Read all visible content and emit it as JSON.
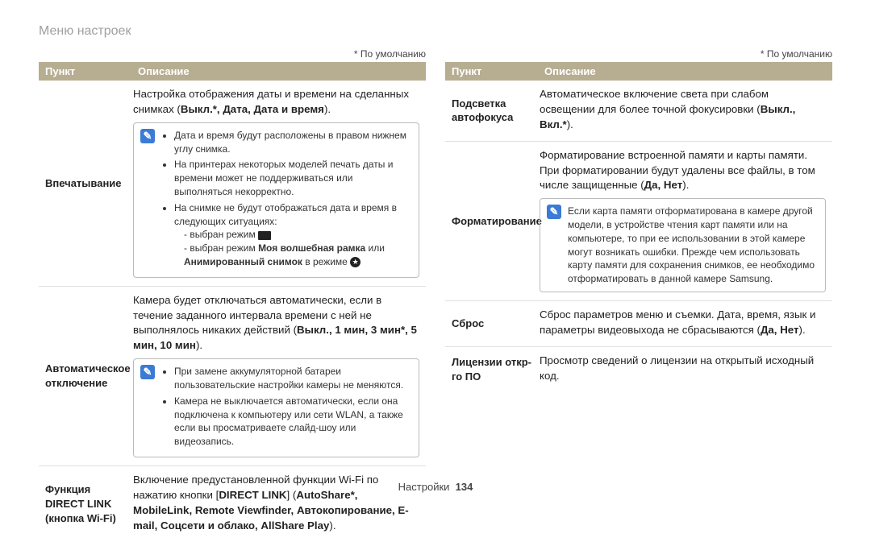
{
  "title": "Меню настроек",
  "default_label": "* По умолчанию",
  "headers": {
    "item": "Пункт",
    "desc": "Описание"
  },
  "footer": {
    "section": "Настройки",
    "page": "134"
  },
  "left": {
    "rows": [
      {
        "label": "Впечатывание",
        "intro_pre": "Настройка отображения даты и времени на сделанных снимках (",
        "intro_bold": "Выкл.*, Дата, Дата и время",
        "intro_post": ").",
        "note": {
          "b1": "Дата и время будут расположены в правом нижнем углу снимка.",
          "b2": "На принтерах некоторых моделей печать даты и времени может не поддерживаться или выполняться некорректно.",
          "b3": "На снимке не будут отображаться дата и время в следующих ситуациях:",
          "s1": "выбран режим ",
          "s2_pre": "выбран режим ",
          "s2_b1": "Моя волшебная рамка",
          "s2_mid": " или ",
          "s2_b2": "Анимированный снимок",
          "s2_post": " в режиме "
        }
      },
      {
        "label": "Автоматическое отключение",
        "intro_pre": "Камера будет отключаться автоматически, если в течение заданного интервала времени с ней не выполнялось никаких действий (",
        "intro_bold": "Выкл., 1 мин, 3 мин*, 5 мин, 10 мин",
        "intro_post": ").",
        "note": {
          "b1": "При замене аккумуляторной батареи пользовательские настройки камеры не меняются.",
          "b2": "Камера не выключается автоматически, если она подключена к компьютеру или сети WLAN, а также если вы просматриваете слайд-шоу или видеозапись."
        }
      },
      {
        "label": "Функция DIRECT LINK (кнопка Wi-Fi)",
        "intro_pre": "Включение предустановленной функции Wi-Fi по нажатию кнопки [",
        "intro_b1": "DIRECT LINK",
        "intro_mid1": "] (",
        "intro_b2": "AutoShare*, MobileLink, Remote Viewfinder, Автокопирование, E-mail, Соцсети и облако, AllShare Play",
        "intro_post": ")."
      }
    ]
  },
  "right": {
    "rows": [
      {
        "label": "Подсветка автофокуса",
        "intro_pre": "Автоматическое включение света при слабом освещении для более точной фокусировки (",
        "intro_bold": "Выкл., Вкл.*",
        "intro_post": ")."
      },
      {
        "label": "Форматирование",
        "intro_pre": "Форматирование встроенной памяти и карты памяти. При форматировании будут удалены все файлы, в том числе защищенные (",
        "intro_bold": "Да, Нет",
        "intro_post": ").",
        "note": {
          "body": "Если карта памяти отформатирована в камере другой модели, в устройстве чтения карт памяти или на компьютере, то при ее использовании в этой камере могут возникать ошибки. Прежде чем использовать карту памяти для сохранения снимков, ее необходимо отформатировать в данной камере Samsung."
        }
      },
      {
        "label": "Сброс",
        "intro_pre": "Сброс параметров меню и съемки. Дата, время, язык и параметры видеовыхода не сбрасываются (",
        "intro_bold": "Да, Нет",
        "intro_post": ")."
      },
      {
        "label": "Лицензии откр-го ПО",
        "intro_pre": "Просмотр сведений о лицензии на открытый исходный код.",
        "intro_bold": "",
        "intro_post": ""
      }
    ]
  }
}
